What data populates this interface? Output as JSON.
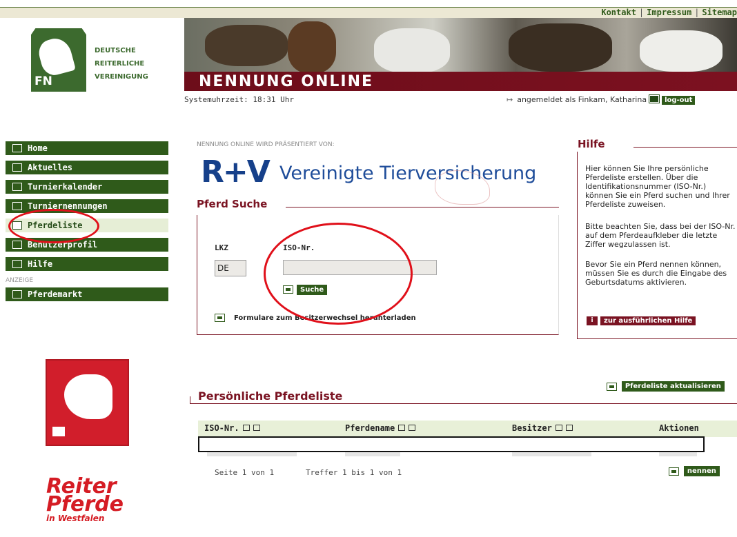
{
  "top_links": [
    "Kontakt",
    "Impressum",
    "Sitemap"
  ],
  "organization": [
    "DEUTSCHE",
    "REITERLICHE",
    "VEREINIGUNG"
  ],
  "logo_text": "FN",
  "banner_title": "NENNUNG ONLINE",
  "system_time": "Systemuhrzeit: 18:31 Uhr",
  "login_status": "angemeldet als Finkam, Katharina",
  "logout_label": "log-out",
  "nav": {
    "items": [
      "Home",
      "Aktuelles",
      "Turnierkalender",
      "Turniernennungen",
      "Pferdeliste",
      "Benutzerprofil",
      "Hilfe"
    ],
    "active": "Pferdeliste",
    "ad_label": "ANZEIGE",
    "ad_item": "Pferdemarkt"
  },
  "reiter_logo": {
    "line1": "Reiter",
    "line2": "Pferde",
    "line3": "in Westfalen"
  },
  "sponsor": {
    "label": "NENNUNG ONLINE WIRD PRÄSENTIERT VON:",
    "logo": "R+V",
    "name": "Vereinigte Tierversicherung"
  },
  "search": {
    "title": "Pferd Suche",
    "lkz_label": "LKZ",
    "lkz_value": "DE",
    "iso_label": "ISO-Nr.",
    "iso_value": "",
    "button": "Suche",
    "forms_link": "Formulare zum Besitzerwechsel herunterladen"
  },
  "help": {
    "title": "Hilfe",
    "paragraphs": [
      "Hier können Sie Ihre persönliche Pferdeliste erstellen. Über die Identifikationsnummer (ISO-Nr.) können Sie ein Pferd suchen und Ihrer Pferdeliste zuweisen.",
      "Bitte beachten Sie, dass bei der ISO-Nr. auf dem Pferdeaufkleber die letzte Ziffer wegzulassen ist.",
      "Bevor Sie ein Pferd nennen können, müssen Sie es durch die Eingabe des Geburtsdatums aktivieren."
    ],
    "button": "zur ausführlichen Hilfe"
  },
  "list": {
    "update_button": "Pferdeliste aktualisieren",
    "title": "Persönliche Pferdeliste",
    "columns": [
      "ISO-Nr.",
      "Pferdename",
      "Besitzer",
      "Aktionen"
    ],
    "page_info": "Seite 1 von 1",
    "hits": "Treffer 1 bis 1 von 1",
    "nennen_button": "nennen"
  },
  "colors": {
    "brand_green": "#2f5a1a",
    "brand_red": "#7a1322",
    "annotation_red": "#e0101a"
  }
}
